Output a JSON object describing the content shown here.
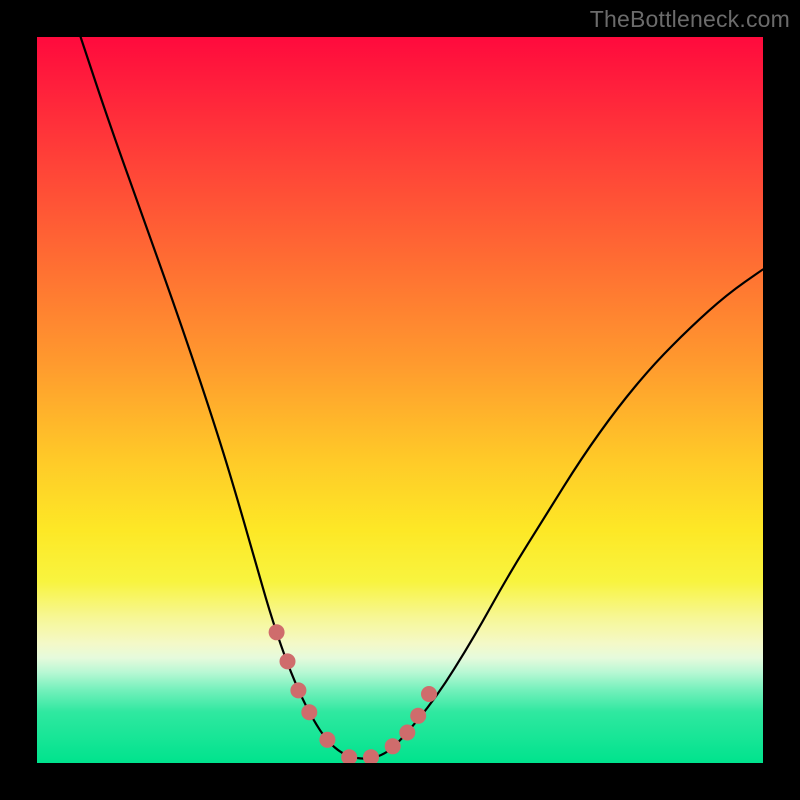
{
  "watermark": "TheBottleneck.com",
  "chart_data": {
    "type": "line",
    "title": "",
    "xlabel": "",
    "ylabel": "",
    "xlim": [
      0,
      100
    ],
    "ylim": [
      0,
      100
    ],
    "grid": false,
    "legend": false,
    "series": [
      {
        "name": "curve",
        "x": [
          6,
          10,
          15,
          20,
          25,
          28,
          30,
          32,
          34,
          36,
          38,
          40,
          42,
          44,
          46,
          48,
          50,
          55,
          60,
          65,
          70,
          75,
          80,
          85,
          90,
          95,
          100
        ],
        "y": [
          100,
          88,
          74,
          60,
          45,
          35,
          28,
          21,
          15,
          10,
          6,
          3,
          1.3,
          0.6,
          0.6,
          1.3,
          3,
          9,
          17,
          26,
          34,
          42,
          49,
          55,
          60,
          64.5,
          68
        ]
      }
    ],
    "markers": {
      "name": "highlight-points",
      "x": [
        33,
        34.5,
        36,
        37.5,
        40,
        43,
        46,
        49,
        51,
        52.5,
        54
      ],
      "y": [
        18,
        14,
        10,
        7,
        3.2,
        0.8,
        0.8,
        2.3,
        4.2,
        6.5,
        9.5
      ]
    }
  }
}
